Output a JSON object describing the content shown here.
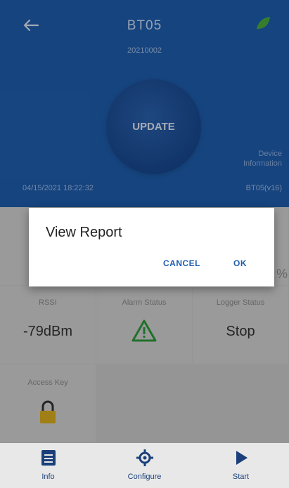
{
  "header": {
    "title": "BT05",
    "serial": "20210002",
    "update_label": "UPDATE",
    "device_info_line1": "Device",
    "device_info_line2": "Information",
    "datetime": "04/15/2021 18:22:32",
    "firmware": "BT05(v16)"
  },
  "tiles": {
    "rssi_label": "RSSI",
    "rssi_value": "-79dBm",
    "alarm_label": "Alarm Status",
    "logger_label": "Logger Status",
    "logger_value": "Stop",
    "access_label": "Access Key"
  },
  "dialog": {
    "title": "View Report",
    "cancel_label": "CANCEL",
    "ok_label": "OK",
    "peek_text": "%"
  },
  "bottom_nav": {
    "items": [
      {
        "label": "Info",
        "icon": "info-icon"
      },
      {
        "label": "Configure",
        "icon": "gear-icon"
      },
      {
        "label": "Start",
        "icon": "play-icon"
      }
    ]
  },
  "colors": {
    "header": "#1f5fb0",
    "accent": "#1f5fb0",
    "tile_bg": "#d6d6d6",
    "alarm_icon": "#2e9b3c",
    "lock_icon": "#e0b020"
  }
}
